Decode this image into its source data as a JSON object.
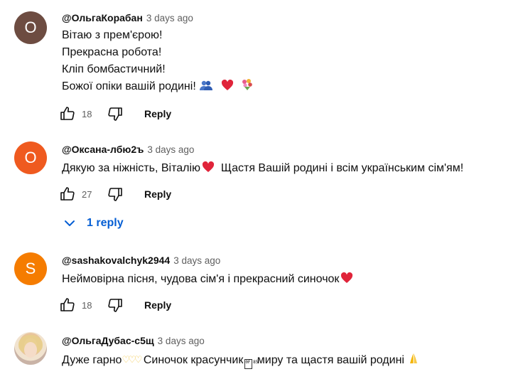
{
  "comments": [
    {
      "avatar_letter": "О",
      "avatar_color": "#6d4c41",
      "author": "@ОльгаКорабан",
      "time": "3 days ago",
      "lines": [
        "Вітаю з прем'єрою!",
        "Прекрасна робота!",
        "Кліп бомбастичний!",
        "Божої опіки вашій родині!"
      ],
      "emoji_trail": [
        "people-hugging-icon",
        "red-heart-icon",
        "bouquet-icon"
      ],
      "likes": "18",
      "reply_label": "Reply"
    },
    {
      "avatar_letter": "О",
      "avatar_color": "#ef5a1f",
      "author": "@Оксана-лбю2ъ",
      "time": "3 days ago",
      "text_before_heart": "Дякую за ніжність, Віталію",
      "text_after_heart": "  Щастя Вашій родині і всім українським сім'ям!",
      "likes": "27",
      "reply_label": "Reply",
      "replies_label": "1 reply"
    },
    {
      "avatar_letter": "S",
      "avatar_color": "#f57c00",
      "author": "@sashakovalchyk2944",
      "time": "3 days ago",
      "text": "Неймовірна пісня, чудова сім'я і прекрасний синочок",
      "likes": "18",
      "reply_label": "Reply"
    },
    {
      "author": "@ОльгаДубас-с5щ",
      "time": "3 days ago",
      "text_part1": "Дуже гарно",
      "hearts": "♡♡♡",
      "text_part2": " Синочок красунчик",
      "glyph": "0F 85",
      "text_part3": " миру та щастя вашій родині ",
      "emoji_end": "folded-hands-icon"
    }
  ],
  "colors": {
    "link_blue": "#065fd4",
    "secondary_text": "#606060",
    "heart_red": "#e0245e"
  }
}
